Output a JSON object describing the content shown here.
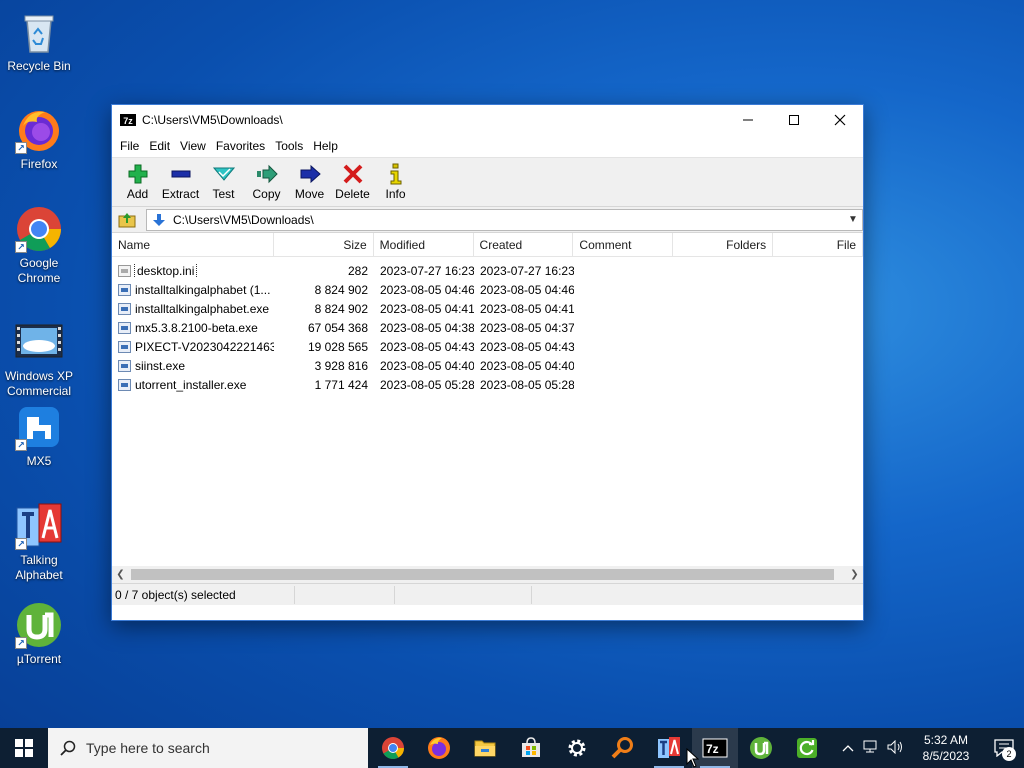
{
  "desktop": {
    "icons": [
      {
        "label": "Recycle Bin"
      },
      {
        "label": "Firefox"
      },
      {
        "label": "Google Chrome"
      },
      {
        "label": "Windows XP Commercial"
      },
      {
        "label": "MX5"
      },
      {
        "label": "Talking Alphabet"
      },
      {
        "label": "µTorrent"
      }
    ]
  },
  "window": {
    "title": "C:\\Users\\VM5\\Downloads\\",
    "app_icon_text": "7z",
    "controls": {
      "minimize": "—",
      "maximize": "☐",
      "close": "✕"
    },
    "menu": [
      "File",
      "Edit",
      "View",
      "Favorites",
      "Tools",
      "Help"
    ],
    "toolbar": [
      "Add",
      "Extract",
      "Test",
      "Copy",
      "Move",
      "Delete",
      "Info"
    ],
    "address": "C:\\Users\\VM5\\Downloads\\",
    "columns": [
      "Name",
      "Size",
      "Modified",
      "Created",
      "Comment",
      "Folders",
      "File"
    ],
    "files": [
      {
        "name": "desktop.ini",
        "size": "282",
        "modified": "2023-07-27 16:23",
        "created": "2023-07-27 16:23"
      },
      {
        "name": "installtalkingalphabet (1...",
        "size": "8 824 902",
        "modified": "2023-08-05 04:46",
        "created": "2023-08-05 04:46"
      },
      {
        "name": "installtalkingalphabet.exe",
        "size": "8 824 902",
        "modified": "2023-08-05 04:41",
        "created": "2023-08-05 04:41"
      },
      {
        "name": "mx5.3.8.2100-beta.exe",
        "size": "67 054 368",
        "modified": "2023-08-05 04:38",
        "created": "2023-08-05 04:37"
      },
      {
        "name": "PIXECT-V2023042221463...",
        "size": "19 028 565",
        "modified": "2023-08-05 04:43",
        "created": "2023-08-05 04:43"
      },
      {
        "name": "siinst.exe",
        "size": "3 928 816",
        "modified": "2023-08-05 04:40",
        "created": "2023-08-05 04:40"
      },
      {
        "name": "utorrent_installer.exe",
        "size": "1 771 424",
        "modified": "2023-08-05 05:28",
        "created": "2023-08-05 05:28"
      }
    ],
    "status": "0 / 7 object(s) selected"
  },
  "taskbar": {
    "search_placeholder": "Type here to search",
    "time": "5:32 AM",
    "date": "8/5/2023",
    "notifications": "2",
    "apps": [
      "chrome",
      "firefox",
      "file-explorer",
      "store",
      "settings",
      "search-app",
      "talking-alphabet",
      "7zip",
      "utorrent",
      "refresh-app"
    ]
  },
  "colors": {
    "desktop_bg": "#1466c9",
    "taskbar_bg": "#0d1f33",
    "window_border": "#3b7bd6"
  }
}
